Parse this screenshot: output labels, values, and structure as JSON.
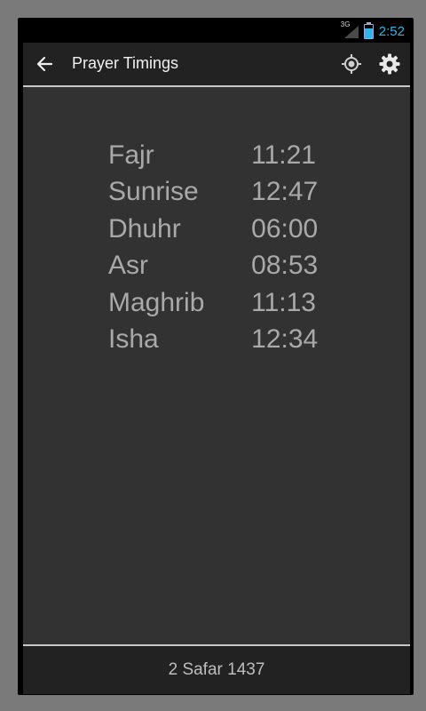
{
  "status": {
    "network": "3G",
    "time": "2:52"
  },
  "app": {
    "title": "Prayer Timings",
    "icons": {
      "back": "arrow-left-icon",
      "location": "gps-location-icon",
      "settings": "gear-icon"
    }
  },
  "prayers": [
    {
      "name": "Fajr",
      "time": "11:21"
    },
    {
      "name": "Sunrise",
      "time": "12:47"
    },
    {
      "name": "Dhuhr",
      "time": "06:00"
    },
    {
      "name": "Asr",
      "time": "08:53"
    },
    {
      "name": "Maghrib",
      "time": "11:13"
    },
    {
      "name": "Isha",
      "time": "12:34"
    }
  ],
  "footer": {
    "hijri_date": "2 Safar 1437"
  },
  "colors": {
    "clock": "#33b5e5",
    "content_bg": "#323232",
    "bar_bg": "#222222",
    "text": "#a9a9a9"
  }
}
